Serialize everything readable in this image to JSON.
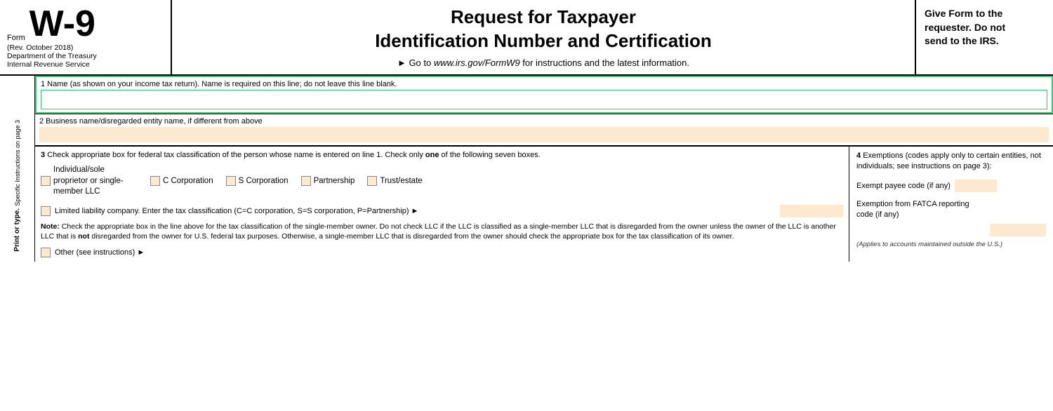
{
  "header": {
    "form_label": "Form",
    "form_number": "W-9",
    "rev_info": "(Rev. October 2018)",
    "dept_line1": "Department of the Treasury",
    "dept_line2": "Internal Revenue Service",
    "main_title_line1": "Request for Taxpayer",
    "main_title_line2": "Identification Number and Certification",
    "subtitle_prefix": "► Go to ",
    "subtitle_url": "www.irs.gov/FormW9",
    "subtitle_suffix": " for instructions and the latest information.",
    "right_text_line1": "Give Form to the",
    "right_text_line2": "requester. Do not",
    "right_text_line3": "send to the IRS."
  },
  "sidebar": {
    "bottom_text": "Print or type.",
    "top_text": "Specific Instructions on page 3"
  },
  "fields": {
    "field1_label": "1  Name (as shown on your income tax return). Name is required on this line; do not leave this line blank.",
    "field2_label": "2  Business name/disregarded entity name, if different from above"
  },
  "section3": {
    "header_num": "3",
    "header_text": "Check appropriate box for federal tax classification of the person whose name is entered on line 1. Check only",
    "header_bold": "one",
    "header_text2": "of the following seven boxes.",
    "checkboxes": [
      {
        "id": "indiv",
        "label_line1": "Individual/sole proprietor or",
        "label_line2": "single-member LLC"
      },
      {
        "id": "c-corp",
        "label": "C Corporation"
      },
      {
        "id": "s-corp",
        "label": "S Corporation"
      },
      {
        "id": "partner",
        "label": "Partnership"
      },
      {
        "id": "trust",
        "label": "Trust/estate"
      }
    ],
    "llc_text": "Limited liability company. Enter the tax classification (C=C corporation, S=S corporation, P=Partnership) ►",
    "note_label": "Note:",
    "note_text": " Check the appropriate box in the line above for the tax classification of the single-member owner.  Do not check LLC if the LLC is classified as a single-member LLC that is disregarded from the owner unless the owner of the LLC is another LLC that is",
    "note_bold2": "not",
    "note_text2": " disregarded from the owner for U.S. federal tax purposes. Otherwise, a single-member LLC that is disregarded from the owner should check the appropriate box for the tax classification of its owner.",
    "other_label": "Other (see instructions) ►"
  },
  "section4": {
    "header_num": "4",
    "header_text": "Exemptions (codes apply only to certain entities, not individuals; see instructions on page 3):",
    "exempt_label": "Exempt payee code (if any)",
    "fatca_line1": "Exemption from FATCA reporting",
    "fatca_line2": "code (if any)",
    "applies_note": "(Applies to accounts maintained outside the U.S.)"
  }
}
